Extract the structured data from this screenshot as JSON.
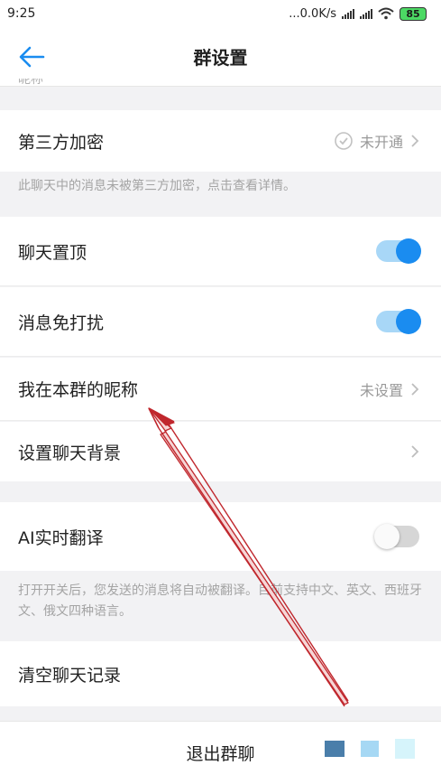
{
  "status": {
    "time": "9:25",
    "network": "...0.0K/s",
    "battery": "85"
  },
  "nav": {
    "title": "群设置"
  },
  "partial_top_text": "昵称",
  "rows": {
    "encryption": {
      "label": "第三方加密",
      "value": "未开通"
    },
    "encryption_hint": "此聊天中的消息未被第三方加密，点击查看详情。",
    "pin": {
      "label": "聊天置顶",
      "state": "on"
    },
    "mute": {
      "label": "消息免打扰",
      "state": "on"
    },
    "nickname": {
      "label": "我在本群的昵称",
      "value": "未设置"
    },
    "background": {
      "label": "设置聊天背景"
    },
    "translate": {
      "label": "AI实时翻译",
      "state": "off"
    },
    "translate_hint": "打开开关后，您发送的消息将自动被翻译。目前支持中文、英文、西班牙文、俄文四种语言。",
    "clear": {
      "label": "清空聊天记录"
    }
  },
  "bottom": {
    "exit_label": "退出群聊"
  },
  "colors": {
    "accent": "#1a8cf0",
    "annotation_arrow": "#c0272d"
  }
}
